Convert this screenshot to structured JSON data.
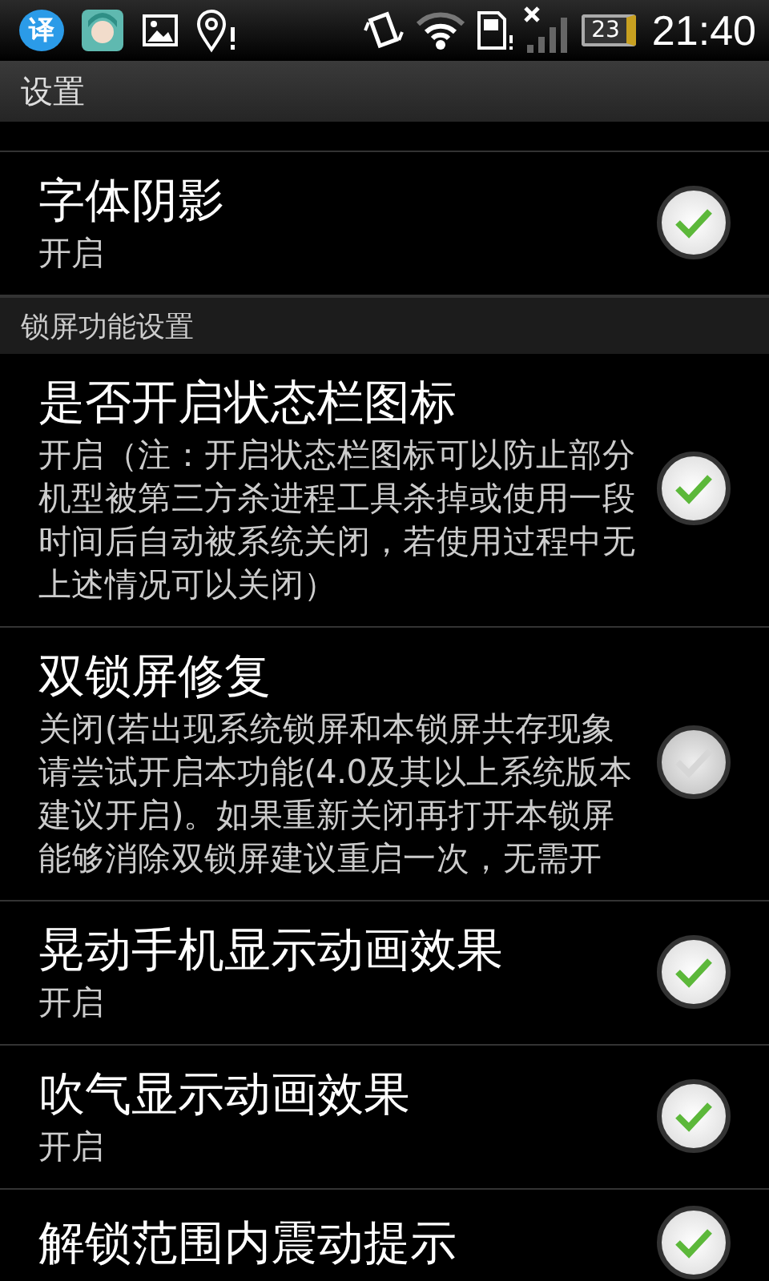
{
  "status_bar": {
    "app_badge": "译",
    "battery": "23",
    "time": "21:40"
  },
  "title_bar": {
    "title": "设置"
  },
  "sections": [
    {
      "items": [
        {
          "title": "字体阴影",
          "summary": "开启",
          "checked": true
        }
      ]
    },
    {
      "header": "锁屏功能设置",
      "items": [
        {
          "title": "是否开启状态栏图标",
          "summary": "开启（注：开启状态栏图标可以防止部分机型被第三方杀进程工具杀掉或使用一段时间后自动被系统关闭，若使用过程中无上述情况可以关闭）",
          "checked": true
        },
        {
          "title": "双锁屏修复",
          "summary": "关闭(若出现系统锁屏和本锁屏共存现象请尝试开启本功能(4.0及其以上系统版本建议开启)。如果重新关闭再打开本锁屏能够消除双锁屏建议重启一次，无需开",
          "checked": false
        },
        {
          "title": "晃动手机显示动画效果",
          "summary": "开启",
          "checked": true
        },
        {
          "title": "吹气显示动画效果",
          "summary": "开启",
          "checked": true
        },
        {
          "title": "解锁范围内震动提示",
          "checked": true
        }
      ]
    }
  ]
}
